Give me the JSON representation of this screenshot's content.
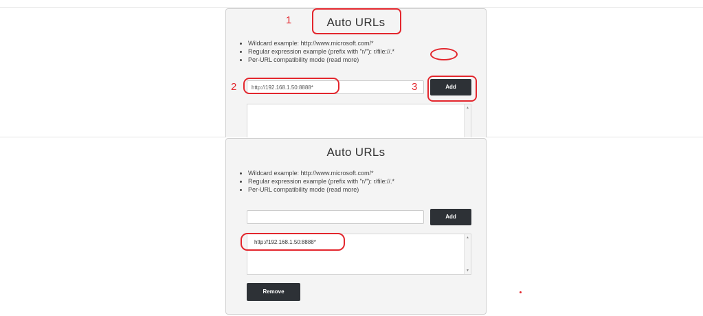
{
  "top_panel": {
    "title": "Auto URLs",
    "notes": [
      "Wildcard example: http://www.microsoft.com/*",
      "Regular expression example (prefix with \"r/\"): r/file://.*",
      "Per-URL compatibility mode (read more)"
    ],
    "url_input_value": "http://192.168.1.50:8888*",
    "add_label": "Add"
  },
  "bottom_panel": {
    "title": "Auto URLs",
    "notes": [
      "Wildcard example: http://www.microsoft.com/*",
      "Regular expression example (prefix with \"r/\"): r/file://.*",
      "Per-URL compatibility mode (read more)"
    ],
    "url_input_value": "",
    "add_label": "Add",
    "url_list": [
      "http://192.168.1.50:8888*"
    ],
    "remove_label": "Remove"
  },
  "annotations": {
    "step1": "1",
    "step2": "2",
    "step3": "3"
  },
  "colors": {
    "highlight": "#e3262d",
    "button": "#2d3136",
    "panel": "#f4f4f4"
  }
}
